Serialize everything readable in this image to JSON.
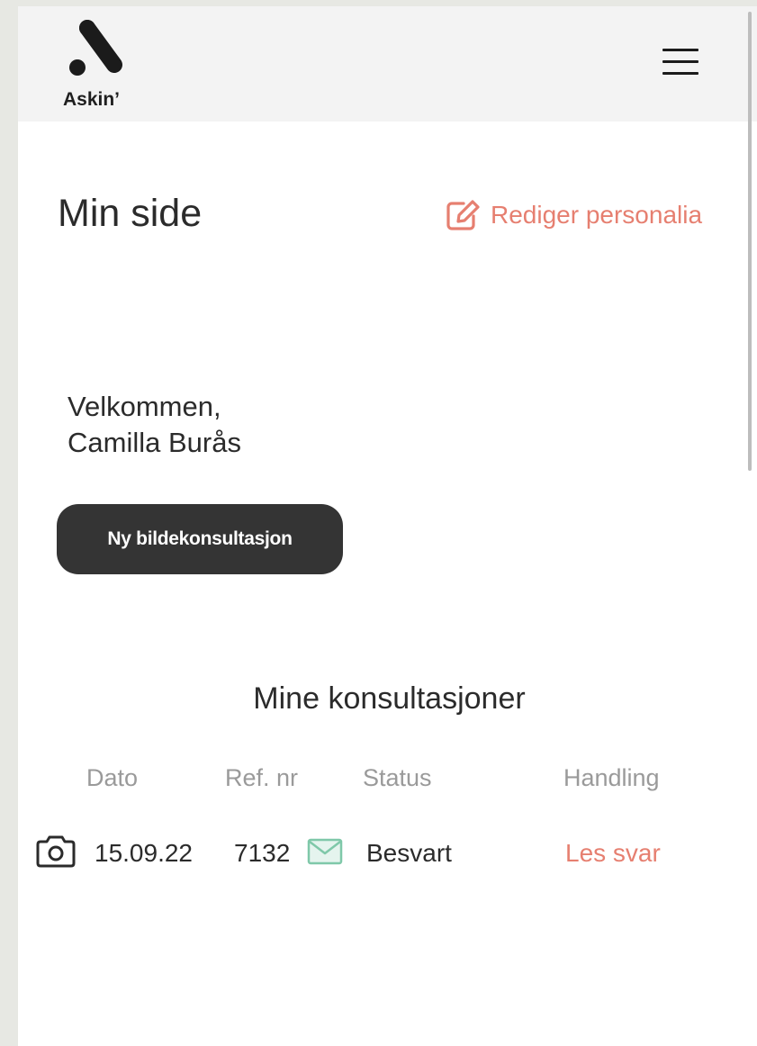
{
  "header": {
    "logo_text": "Askin’",
    "menu_icon": "hamburger-menu-icon"
  },
  "page": {
    "title": "Min side",
    "edit_link_label": "Rediger personalia",
    "edit_icon": "edit-icon"
  },
  "welcome": {
    "line1": "Velkommen,",
    "name": "Camilla Burås"
  },
  "new_consultation_button": "Ny bildekonsultasjon",
  "consultations": {
    "title": "Mine konsultasjoner",
    "columns": [
      "Dato",
      "Ref. nr",
      "Status",
      "Handling"
    ],
    "rows": [
      {
        "type_icon": "camera-icon",
        "date": "15.09.22",
        "ref": "7132",
        "message_icon": "mail-icon",
        "status": "Besvart",
        "action": "Les svar"
      }
    ]
  },
  "colors": {
    "accent": "#e67f70",
    "button_bg": "#343434",
    "header_bg": "#f3f3f3",
    "muted_text": "#9a9a9a",
    "mail_icon": "#7fc8a9"
  }
}
